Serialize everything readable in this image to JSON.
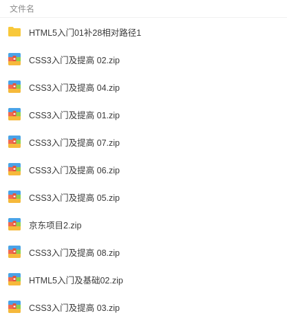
{
  "header": {
    "column_name_label": "文件名"
  },
  "files": [
    {
      "name": "HTML5入门01补28相对路径1",
      "type": "folder",
      "icon": "folder-icon"
    },
    {
      "name": "CSS3入门及提高 02.zip",
      "type": "zip",
      "icon": "zip-archive-icon"
    },
    {
      "name": "CSS3入门及提高 04.zip",
      "type": "zip",
      "icon": "zip-archive-icon"
    },
    {
      "name": "CSS3入门及提高 01.zip",
      "type": "zip",
      "icon": "zip-archive-icon"
    },
    {
      "name": "CSS3入门及提高 07.zip",
      "type": "zip",
      "icon": "zip-archive-icon"
    },
    {
      "name": "CSS3入门及提高 06.zip",
      "type": "zip",
      "icon": "zip-archive-icon"
    },
    {
      "name": "CSS3入门及提高 05.zip",
      "type": "zip",
      "icon": "zip-archive-icon"
    },
    {
      "name": "京东项目2.zip",
      "type": "zip",
      "icon": "zip-archive-icon"
    },
    {
      "name": "CSS3入门及提高 08.zip",
      "type": "zip",
      "icon": "zip-archive-icon"
    },
    {
      "name": "HTML5入门及基础02.zip",
      "type": "zip",
      "icon": "zip-archive-icon"
    },
    {
      "name": "CSS3入门及提高 03.zip",
      "type": "zip",
      "icon": "zip-archive-icon"
    }
  ],
  "colors": {
    "folder": "#f8c83a",
    "zip_top": "#4aa3e8",
    "zip_left": "#f06a4f",
    "zip_right": "#8fcf4c",
    "zip_bottom": "#f6b93b",
    "zip_center": "#e5533d"
  }
}
